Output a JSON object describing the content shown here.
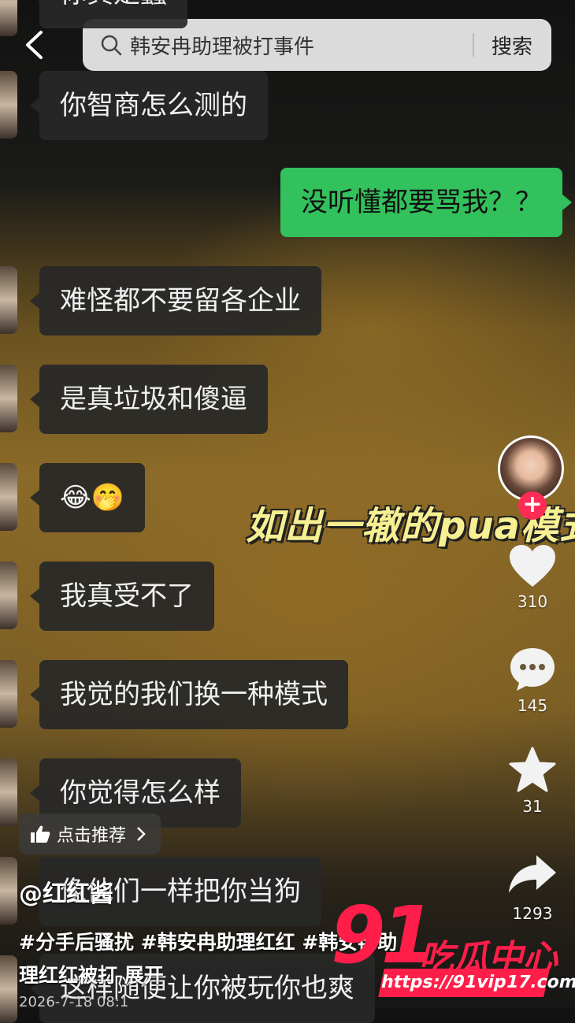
{
  "search": {
    "query": "韩安冉助理被打事件",
    "button": "搜索"
  },
  "chat": {
    "messages": [
      {
        "text": "你真是蠢",
        "side": "left"
      },
      {
        "text": "你智商怎么测的",
        "side": "left"
      },
      {
        "text": "没听懂都要骂我？？",
        "side": "right"
      },
      {
        "text": "难怪都不要留各企业",
        "side": "left"
      },
      {
        "text": "是真垃圾和傻逼",
        "side": "left"
      },
      {
        "text": "😂🤭",
        "side": "left"
      },
      {
        "text": "我真受不了",
        "side": "left"
      },
      {
        "text": "我觉的我们换一种模式",
        "side": "left"
      },
      {
        "text": "你觉得怎么样",
        "side": "left"
      },
      {
        "text": "像他们一样把你当狗",
        "side": "left"
      },
      {
        "text": "这样随便让你被玩你也爽",
        "side": "left"
      }
    ]
  },
  "overlay_caption": "如出一辙的pua模式",
  "actions": {
    "likes": "310",
    "comments": "145",
    "favorites": "31",
    "shares": "1293"
  },
  "recommend_label": "点击推荐",
  "post": {
    "username": "@红红酱",
    "hashtags": [
      "#分手后骚扰",
      "#韩安冉助理红红",
      "#韩安冉助",
      "理红红被打"
    ],
    "expand": "展开",
    "date": "2026-7-18 08:1"
  },
  "watermark": {
    "number": "91",
    "text": "吃瓜中心",
    "url": "https://91vip17.com"
  },
  "colors": {
    "accent": "#fe2c55",
    "my_bubble": "#32c15c"
  }
}
